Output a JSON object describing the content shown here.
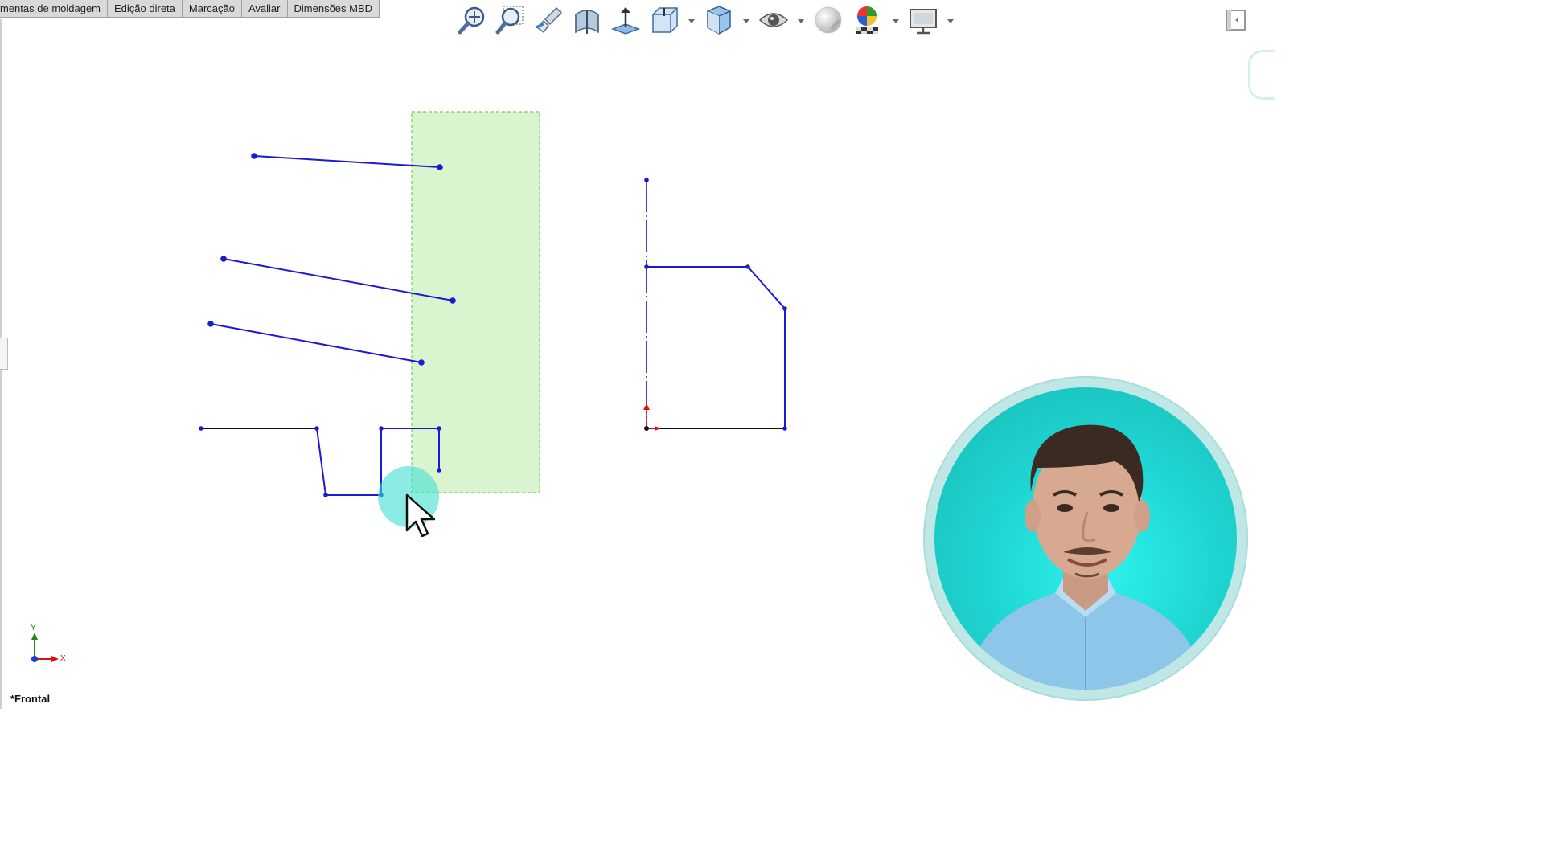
{
  "window": {
    "tabs": [
      {
        "label": "mentas de moldagem"
      },
      {
        "label": "Edição direta"
      },
      {
        "label": "Marcação"
      },
      {
        "label": "Avaliar"
      },
      {
        "label": "Dimensões MBD"
      }
    ]
  },
  "toolbar": {
    "icons": [
      {
        "name": "zoom-to-fit-icon"
      },
      {
        "name": "zoom-to-area-icon"
      },
      {
        "name": "previous-view-icon"
      },
      {
        "name": "section-view-icon"
      },
      {
        "name": "normal-to-icon"
      },
      {
        "name": "view-orientation-icon"
      },
      {
        "name": "display-style-icon"
      },
      {
        "name": "hide-show-items-icon"
      },
      {
        "name": "edit-appearance-icon"
      },
      {
        "name": "apply-scene-icon"
      },
      {
        "name": "view-settings-icon"
      }
    ]
  },
  "viewport": {
    "view_label": "*Frontal",
    "triad": {
      "x_label": "X",
      "y_label": "Y"
    },
    "colors": {
      "sketch_line": "#1a1ad4",
      "fixed_line": "#111111",
      "selection_box": "#7ed957",
      "origin_axis": "#e01010",
      "highlight": "#3fe0d0"
    }
  },
  "webcam": {
    "visible": true
  }
}
